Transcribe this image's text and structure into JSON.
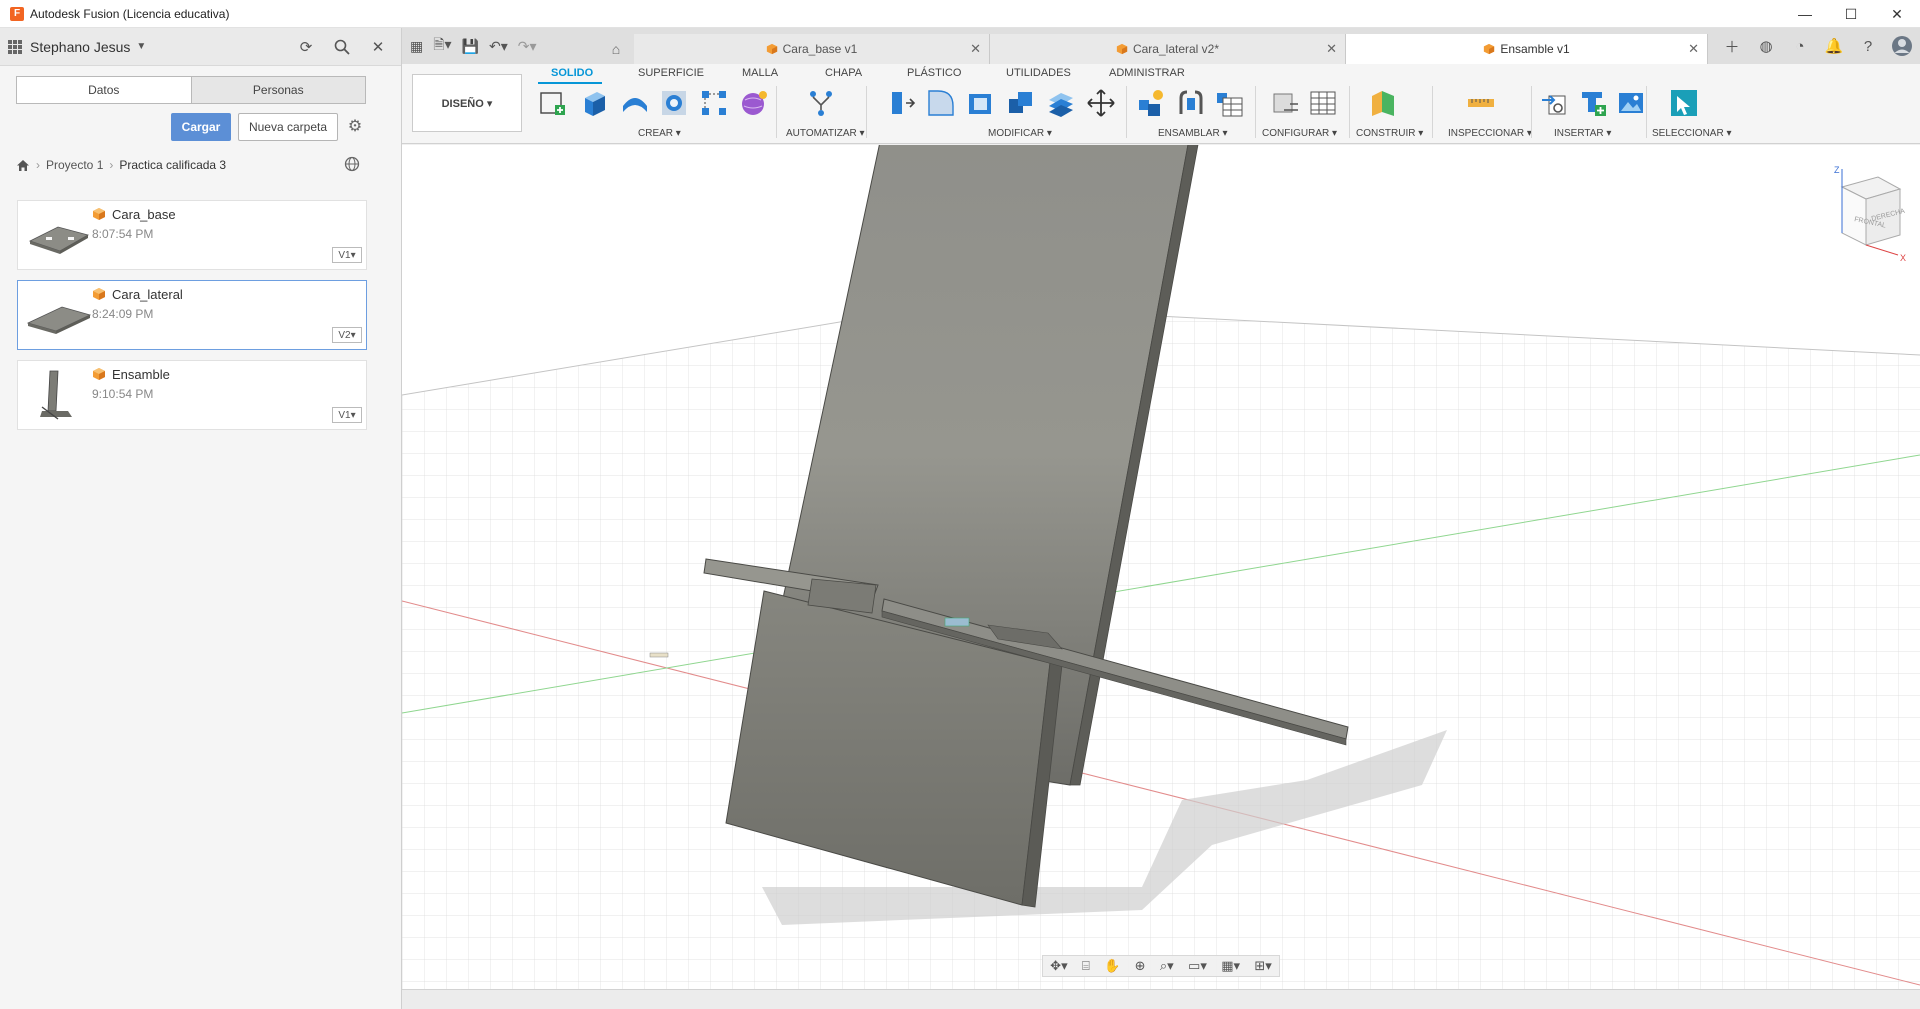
{
  "window": {
    "title": "Autodesk Fusion (Licencia educativa)",
    "logo_letter": "F",
    "controls": [
      "—",
      "☐",
      "✕"
    ]
  },
  "data_panel": {
    "user": "Stephano Jesus",
    "tabs": [
      "Datos",
      "Personas"
    ],
    "upload_button": "Cargar",
    "new_folder_button": "Nueva carpeta",
    "breadcrumb": [
      "Proyecto 1",
      "Practica calificada 3"
    ],
    "files": [
      {
        "name": "Cara_base",
        "time": "8:07:54 PM",
        "version": "V1▾"
      },
      {
        "name": "Cara_lateral",
        "time": "8:24:09 PM",
        "version": "V2▾"
      },
      {
        "name": "Ensamble",
        "time": "9:10:54 PM",
        "version": "V1▾"
      }
    ]
  },
  "doc_tabs": [
    {
      "label": "Cara_base v1"
    },
    {
      "label": "Cara_lateral v2*"
    },
    {
      "label": "Ensamble v1"
    }
  ],
  "toolbar": {
    "workspace": "DISEÑO ▾",
    "tabs": [
      "SOLIDO",
      "SUPERFICIE",
      "MALLA",
      "CHAPA",
      "PLÁSTICO",
      "UTILIDADES",
      "ADMINISTRAR"
    ],
    "groups": [
      "CREAR ▾",
      "AUTOMATIZAR ▾",
      "MODIFICAR ▾",
      "ENSAMBLAR ▾",
      "CONFIGURAR ▾",
      "CONSTRUIR ▾",
      "INSPECCIONAR ▾",
      "INSERTAR ▾",
      "SELECCIONAR ▾"
    ]
  },
  "viewcube": {
    "front": "FRONTAL",
    "right": "DERECHA",
    "axis_z": "Z",
    "axis_x": "X"
  },
  "colors": {
    "accent": "#0696d7",
    "primary_button": "#5c8fd6",
    "fusion_orange": "#f26522",
    "part_gray": "#8a8a82"
  }
}
